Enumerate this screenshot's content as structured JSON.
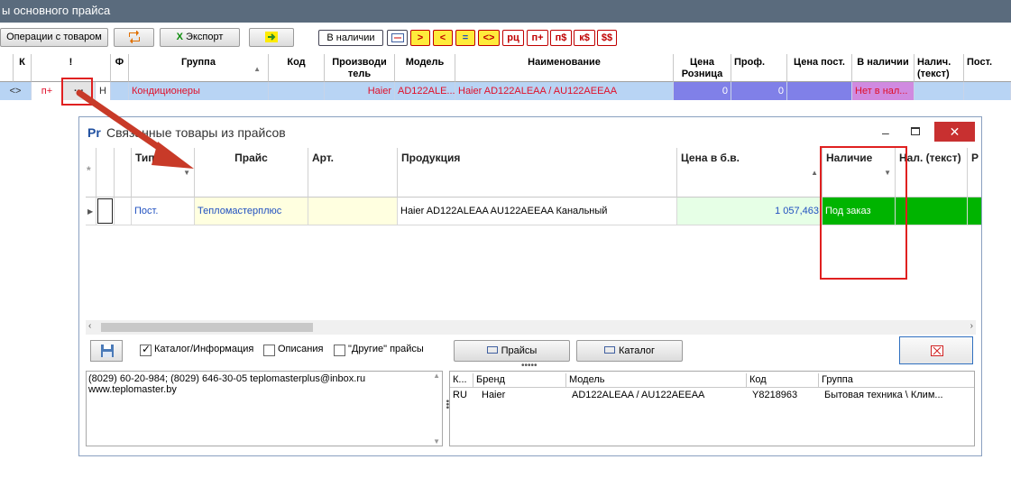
{
  "window": {
    "title": "ы основного прайса"
  },
  "toolbar": {
    "ops_label": "Операции с товаром",
    "export_label": "Экспорт",
    "in_stock_label": "В наличии",
    "filters": [
      ">",
      "<",
      "=",
      "<>",
      "рц",
      "п+",
      "п$",
      "к$",
      "$$"
    ]
  },
  "main_grid": {
    "headers": {
      "k": "К",
      "excl": "!",
      "f": "Ф",
      "group": "Группа",
      "code": "Код",
      "producer": "Производи тель",
      "model": "Модель",
      "name": "Наименование",
      "price_retail": "Цена Розница",
      "prof": "Проф.",
      "price_post": "Цена пост.",
      "in_stock": "В наличии",
      "in_stock_text": "Налич. (текст)",
      "post": "Пост."
    },
    "row": {
      "sym": "<>",
      "flag": "п+",
      "dots": "···",
      "h": "Н",
      "group": "Кондиционеры",
      "producer": "Haier",
      "model": "AD122ALE...",
      "name": "Haier AD122ALEAA / AU122AEEAA",
      "price_retail": "0",
      "prof": "0",
      "in_stock": "Нет в нал..."
    }
  },
  "dialog": {
    "title": "Связанные товары из прайсов",
    "title_icon": "Pr",
    "headers": {
      "star": "*",
      "type": "Тип",
      "price": "Прайс",
      "art": "Арт.",
      "product": "Продукция",
      "price_bv": "Цена в б.в.",
      "availability": "Наличие",
      "avail_text": "Нал. (текст)",
      "more": "Р"
    },
    "row": {
      "type": "Пост.",
      "price": "Тепломастерплюс",
      "product": "Haier AD122ALEAA AU122AEEAA Канальный",
      "price_bv": "1 057,463",
      "availability": "Под заказ"
    },
    "checks": [
      {
        "label": "Каталог/Информация",
        "checked": true
      },
      {
        "label": "Описания",
        "checked": false
      },
      {
        "label": "\"Другие\" прайсы",
        "checked": false
      }
    ],
    "btn_prices": "Прайсы",
    "btn_catalog": "Каталог",
    "contact_lines": [
      "(8029) 60-20-984; (8029) 646-30-05 teplomasterplus@inbox.ru",
      "www.teplomaster.by"
    ],
    "bottom_grid": {
      "headers": [
        "К...",
        "Бренд",
        "Модель",
        "Код",
        "Группа"
      ],
      "row": [
        "RU",
        "Haier",
        "AD122ALEAA / AU122AEEAA",
        "Y8218963",
        "Бытовая техника \\ Клим..."
      ]
    }
  },
  "colors": {
    "accent_red": "#c00000",
    "row_select": "#b8d4f4",
    "avail_green": "#00b400",
    "price_bv_bg": "#e6ffe6"
  }
}
